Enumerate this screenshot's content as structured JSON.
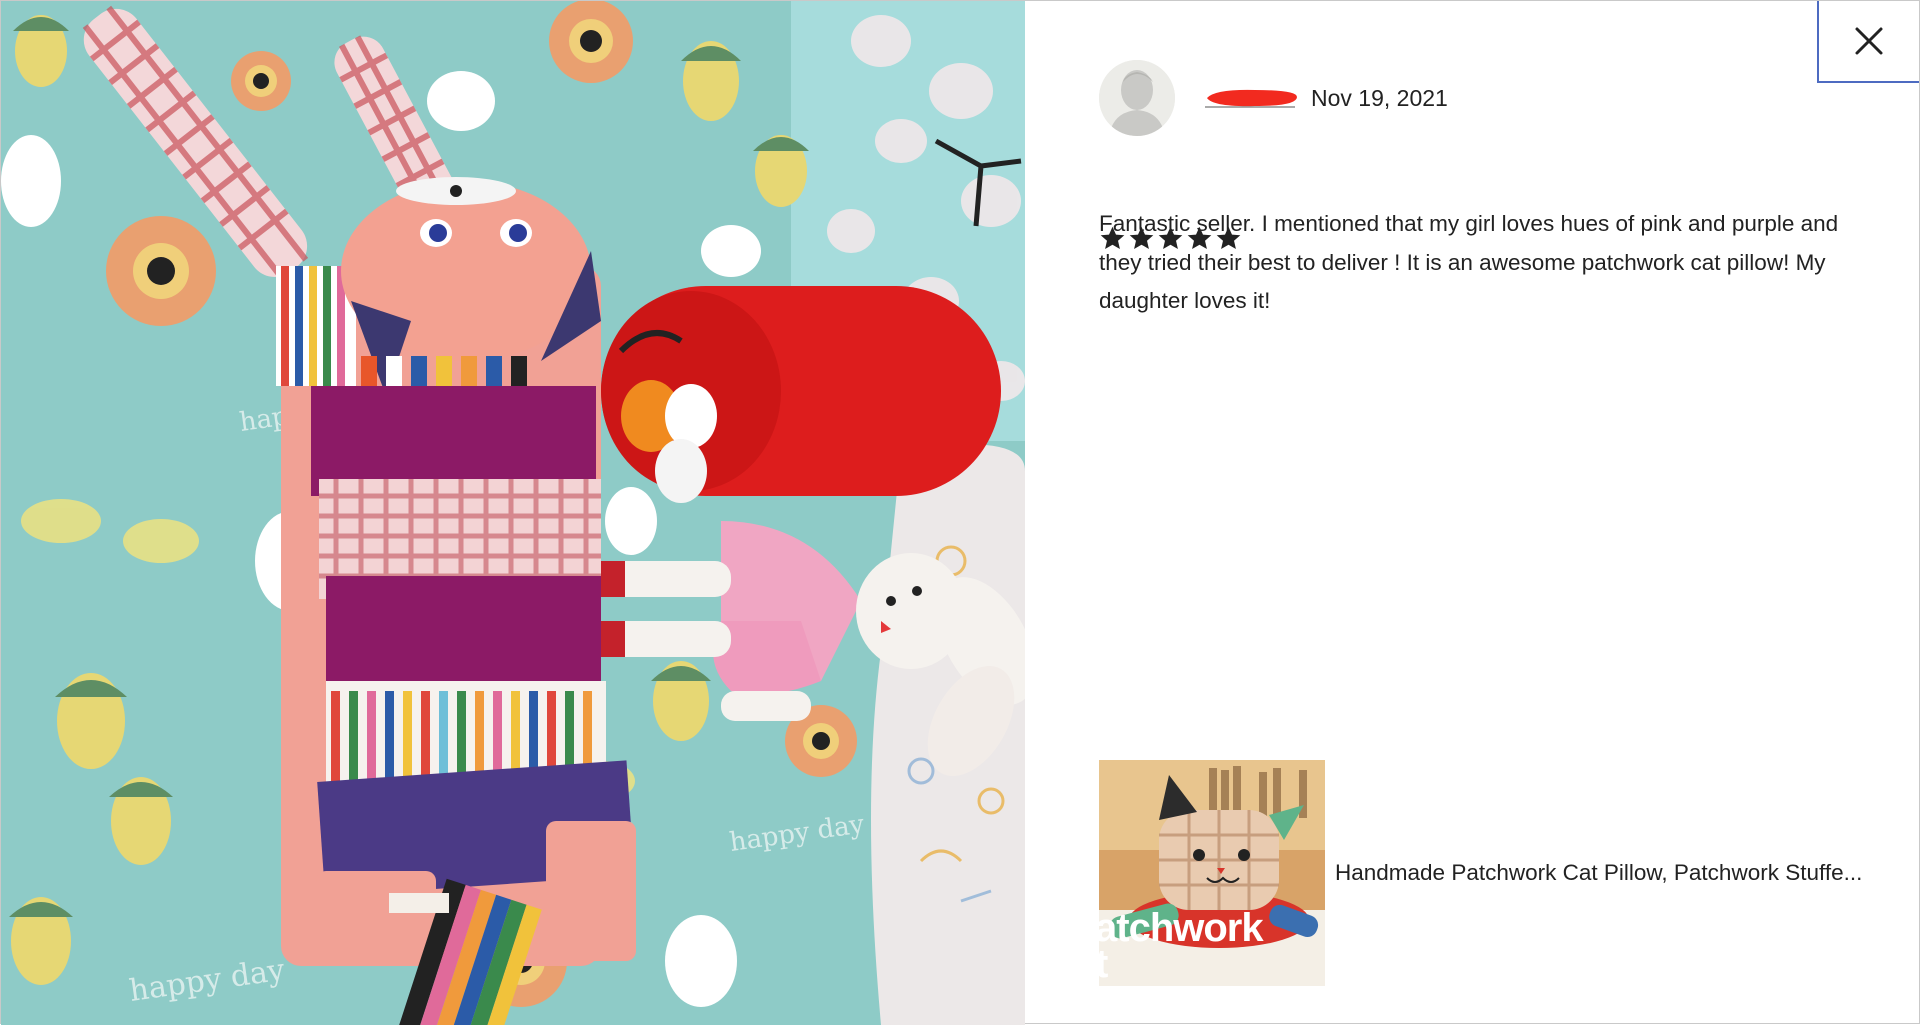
{
  "dialog": {
    "close_icon": "close-icon",
    "close_label": "Close"
  },
  "photo": {
    "description_icon": "review-photo",
    "label_text": "happy day"
  },
  "review": {
    "avatar_icon": "user-avatar-icon",
    "reviewer_name": "",
    "date": "Nov 19, 2021",
    "rating": 5,
    "rating_max": 5,
    "star_icon": "star-icon",
    "text": "Fantastic seller. I mentioned that my girl loves hues of pink and purple and they tried their best to deliver ! It is an awesome patchwork cat pillow! My daughter loves it!"
  },
  "product": {
    "title": "Handmade Patchwork Cat Pillow, Patchwork Stuffe...",
    "thumbnail_overlay": "atchwork\nt"
  },
  "colors": {
    "accent_border": "#4d6bc1",
    "text": "#222222",
    "star": "#222222",
    "redaction": "#ff0000"
  }
}
